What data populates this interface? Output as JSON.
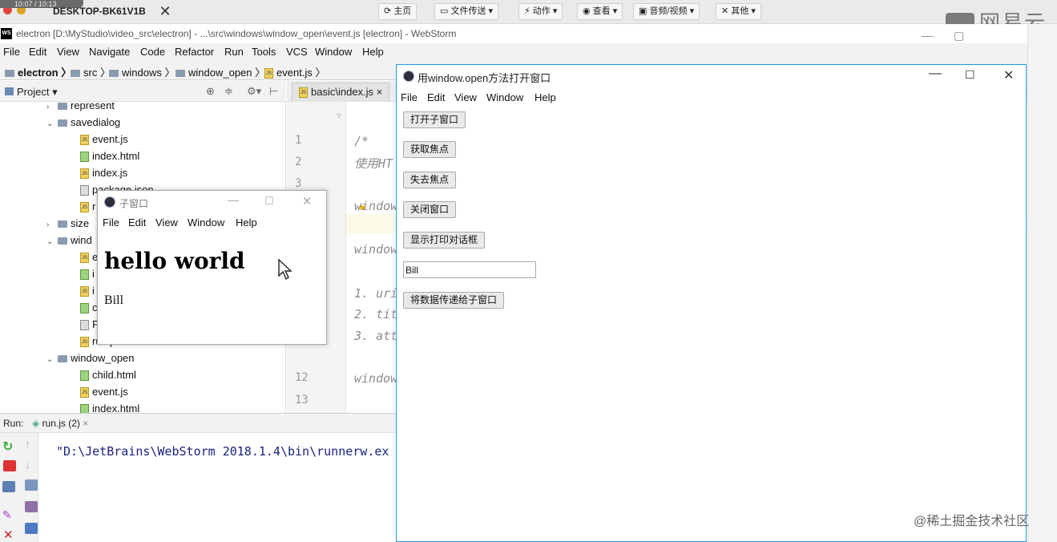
{
  "remote": {
    "timer": "10:07 / 10:13",
    "host": "DESKTOP-BK61V1B",
    "buttons": [
      "主页",
      "文件传送",
      "动作",
      "查看",
      "音频/视频",
      "其他"
    ],
    "watermark": "网易云"
  },
  "ide": {
    "title": "electron [D:\\MyStudio\\video_src\\electron] - ...\\src\\windows\\window_open\\event.js [electron] - WebStorm",
    "logo": "WS",
    "menu": [
      "File",
      "Edit",
      "View",
      "Navigate",
      "Code",
      "Refactor",
      "Run",
      "Tools",
      "VCS",
      "Window",
      "Help"
    ],
    "breadcrumbs": [
      "electron",
      "src",
      "windows",
      "window_open",
      "event.js"
    ],
    "project_label": "Project",
    "tree": [
      {
        "label": "represent",
        "kind": "folder",
        "expand": "›"
      },
      {
        "label": "savedialog",
        "kind": "folder",
        "expand": "⌄"
      },
      {
        "label": "event.js",
        "kind": "js"
      },
      {
        "label": "index.html",
        "kind": "html"
      },
      {
        "label": "index.js",
        "kind": "js"
      },
      {
        "label": "package.json",
        "kind": "json"
      },
      {
        "label": "r",
        "kind": "js"
      },
      {
        "label": "size",
        "kind": "folder",
        "expand": "›"
      },
      {
        "label": "wind",
        "kind": "folder",
        "expand": "⌄"
      },
      {
        "label": "e",
        "kind": "js"
      },
      {
        "label": "i",
        "kind": "html"
      },
      {
        "label": "i",
        "kind": "js"
      },
      {
        "label": "c",
        "kind": "html"
      },
      {
        "label": "P",
        "kind": "json"
      },
      {
        "label": "run.js",
        "kind": "js"
      },
      {
        "label": "window_open",
        "kind": "folder",
        "expand": "⌄"
      },
      {
        "label": "child.html",
        "kind": "html"
      },
      {
        "label": "event.js",
        "kind": "js"
      },
      {
        "label": "index.html",
        "kind": "html"
      }
    ],
    "editor_tab": "basic\\index.js",
    "line_numbers": [
      "1",
      "2",
      "3",
      "4",
      "",
      "",
      "",
      "",
      "",
      "",
      "",
      "12",
      "13"
    ],
    "code": [
      "/*",
      "使用HT",
      "window",
      "window",
      "1. uri",
      "2. tit",
      "3. att",
      "window"
    ],
    "run_label": "Run:",
    "run_tab": "run.js (2)",
    "run_output": "\"D:\\JetBrains\\WebStorm 2018.1.4\\bin\\runnerw.ex"
  },
  "main_window": {
    "title": "用window.open方法打开窗口",
    "menu": [
      "File",
      "Edit",
      "View",
      "Window",
      "Help"
    ],
    "buttons": [
      "打开子窗口",
      "获取焦点",
      "失去焦点",
      "关闭窗口",
      "显示打印对话框",
      "将数据传递给子窗口"
    ],
    "input_value": "Bill"
  },
  "child_window": {
    "title": "子窗口",
    "menu": [
      "File",
      "Edit",
      "View",
      "Window",
      "Help"
    ],
    "heading": "hello world",
    "text": "Bill"
  },
  "watermark_bottom": "@稀土掘金技术社区"
}
